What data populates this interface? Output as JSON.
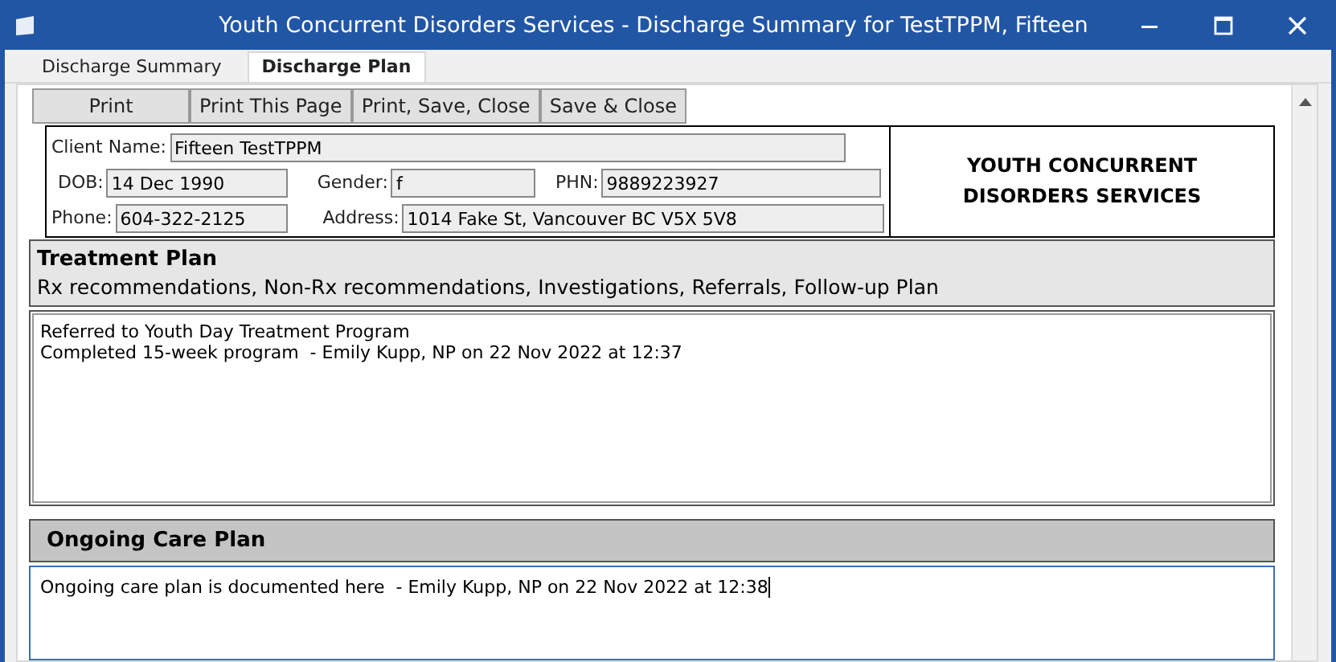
{
  "window": {
    "title": "Youth Concurrent Disorders Services - Discharge Summary for TestTPPM, Fifteen"
  },
  "tabs": [
    {
      "label": "Discharge Summary",
      "selected": false
    },
    {
      "label": "Discharge Plan",
      "selected": true
    }
  ],
  "toolbar": [
    "Print",
    "Print This Page",
    "Print, Save, Close",
    "Save & Close"
  ],
  "client": {
    "name_label": "Client Name:",
    "name": "Fifteen TestTPPM",
    "dob_label": "DOB:",
    "dob": "14 Dec 1990",
    "gender_label": "Gender:",
    "gender": "f",
    "phn_label": "PHN:",
    "phn": "9889223927",
    "phone_label": "Phone:",
    "phone": "604-322-2125",
    "address_label": "Address:",
    "address": "1014 Fake St, Vancouver BC V5X 5V8"
  },
  "org_name": "YOUTH CONCURRENT DISORDERS SERVICES",
  "sections": [
    {
      "title": "Treatment Plan",
      "subtitle": "Rx recommendations, Non-Rx recommendations, Investigations, Referrals, Follow-up Plan",
      "lines": [
        "Referred to Youth Day Treatment Program",
        "Completed 15-week program  - Emily Kupp, NP on 22 Nov 2022 at 12:37"
      ],
      "focused": false
    },
    {
      "title": "Ongoing Care Plan",
      "lines": [
        "Ongoing care plan is documented here  - Emily Kupp, NP on 22 Nov 2022 at 12:38"
      ],
      "focused": true
    }
  ]
}
